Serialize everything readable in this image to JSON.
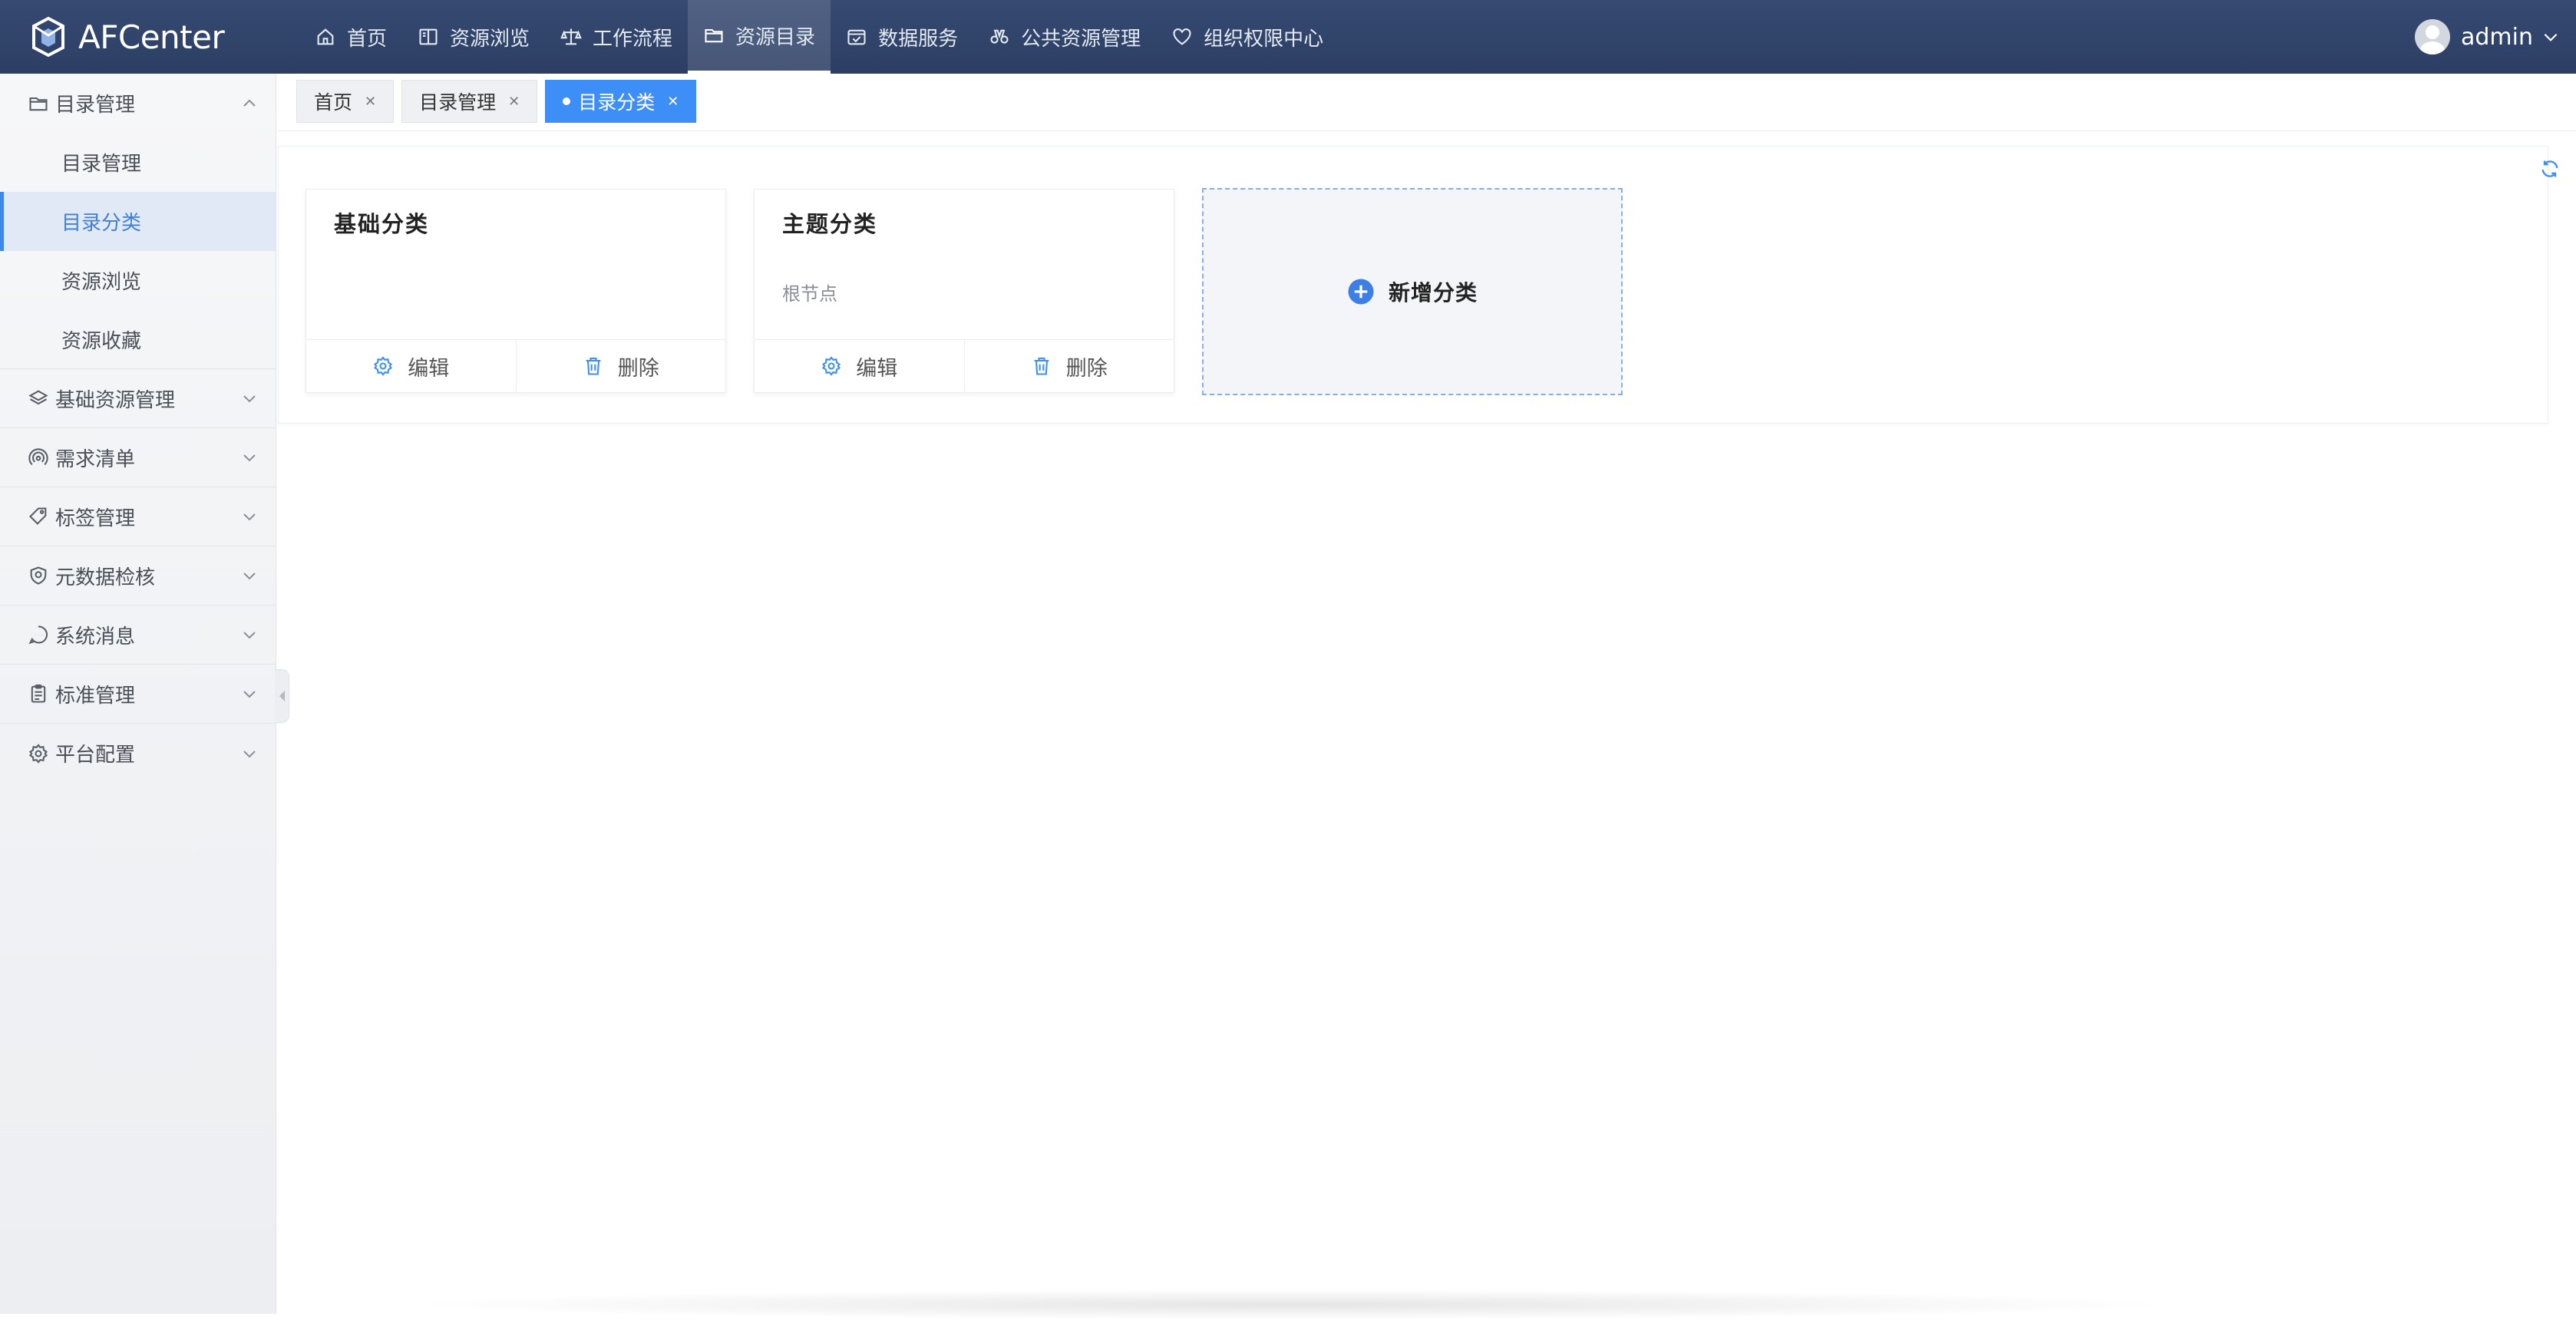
{
  "app": {
    "name": "AFCenter"
  },
  "nav": {
    "items": [
      {
        "label": "首页",
        "icon": "home-icon"
      },
      {
        "label": "资源浏览",
        "icon": "book-icon"
      },
      {
        "label": "工作流程",
        "icon": "scale-icon"
      },
      {
        "label": "资源目录",
        "icon": "folder-icon",
        "active": true
      },
      {
        "label": "数据服务",
        "icon": "calendar-check-icon"
      },
      {
        "label": "公共资源管理",
        "icon": "binoculars-icon"
      },
      {
        "label": "组织权限中心",
        "icon": "shield-heart-icon"
      }
    ]
  },
  "user": {
    "name": "admin"
  },
  "sidebar": {
    "group_catalog": {
      "label": "目录管理",
      "icon": "folder-icon",
      "items": [
        {
          "label": "目录管理"
        },
        {
          "label": "目录分类",
          "active": true
        },
        {
          "label": "资源浏览"
        },
        {
          "label": "资源收藏"
        }
      ]
    },
    "groups": [
      {
        "label": "基础资源管理",
        "icon": "layers-icon"
      },
      {
        "label": "需求清单",
        "icon": "signal-icon"
      },
      {
        "label": "标签管理",
        "icon": "tag-icon"
      },
      {
        "label": "元数据检核",
        "icon": "shield-check-icon"
      },
      {
        "label": "系统消息",
        "icon": "chat-icon"
      },
      {
        "label": "标准管理",
        "icon": "clipboard-icon"
      },
      {
        "label": "平台配置",
        "icon": "gear-icon"
      }
    ]
  },
  "tabs": [
    {
      "label": "首页"
    },
    {
      "label": "目录管理"
    },
    {
      "label": "目录分类",
      "active": true
    }
  ],
  "cards": [
    {
      "title": "基础分类",
      "description": "",
      "edit_label": "编辑",
      "delete_label": "删除"
    },
    {
      "title": "主题分类",
      "description": "根节点",
      "edit_label": "编辑",
      "delete_label": "删除"
    }
  ],
  "add_card": {
    "label": "新增分类"
  },
  "colors": {
    "topbar": "#2c3e63",
    "accent": "#3e8ef7",
    "sidebar_active_bg": "#e2e9f6",
    "sidebar_active_text": "#3f7fd8"
  }
}
